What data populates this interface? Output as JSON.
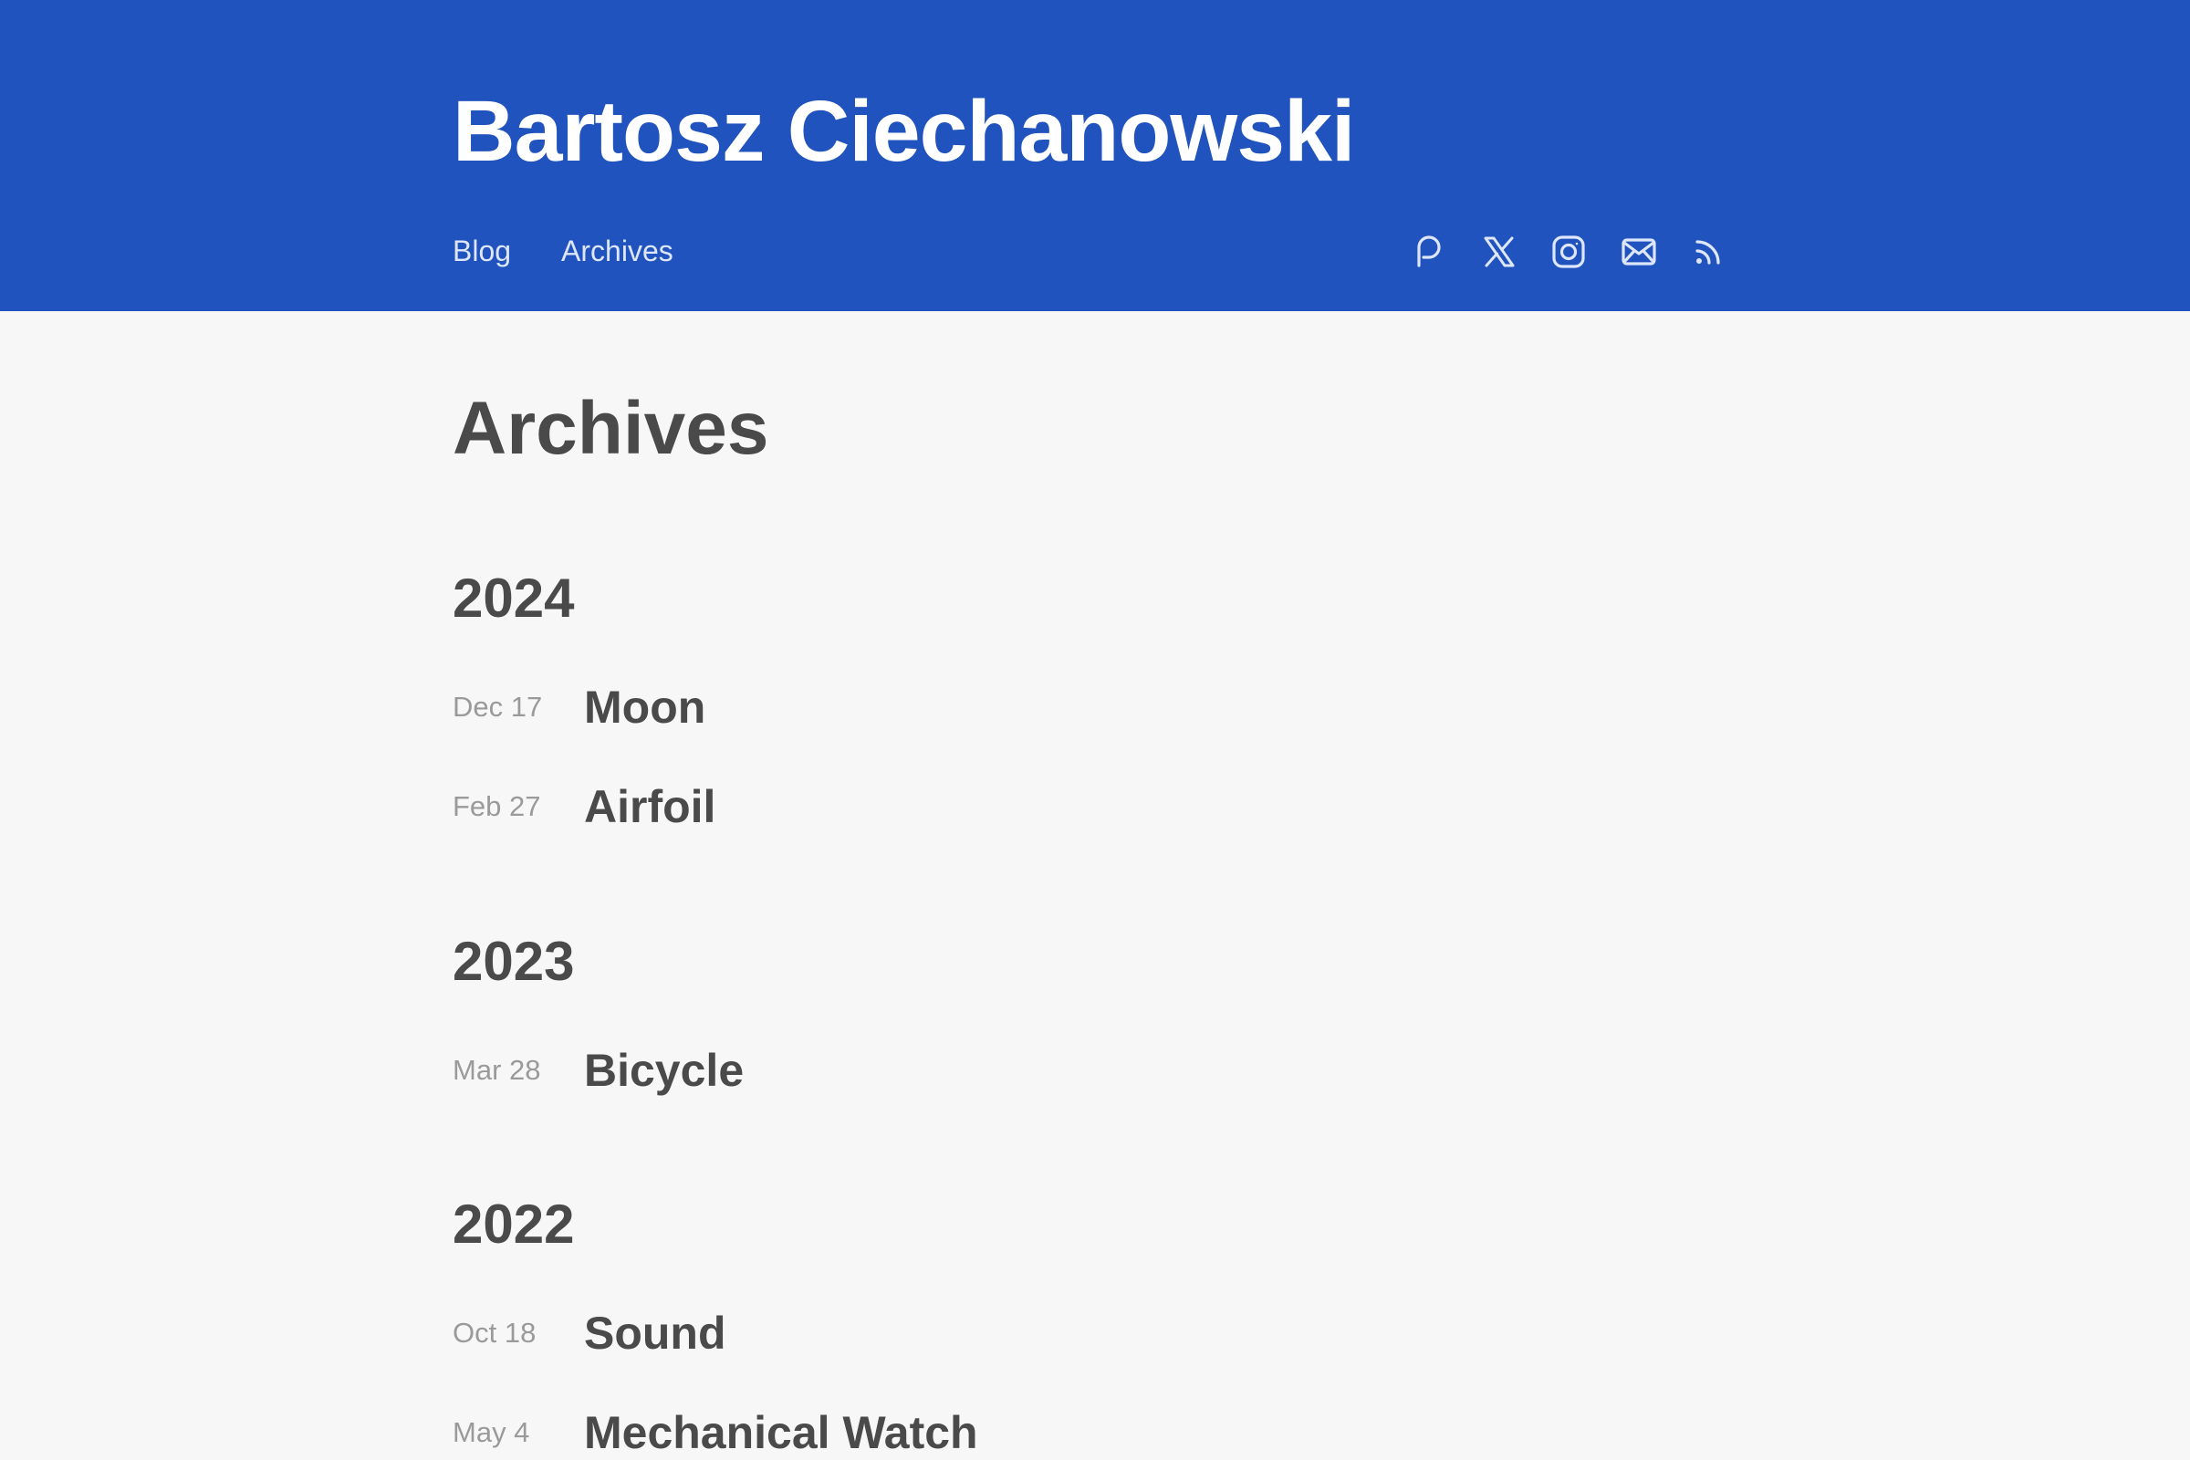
{
  "header": {
    "site_title": "Bartosz Ciechanowski",
    "nav": [
      {
        "label": "Blog"
      },
      {
        "label": "Archives"
      }
    ],
    "social_icons": [
      "patreon-icon",
      "x-icon",
      "instagram-icon",
      "mail-icon",
      "rss-icon"
    ],
    "background_color": "#2053bd"
  },
  "main": {
    "title": "Archives",
    "years": [
      {
        "year": "2024",
        "posts": [
          {
            "date": "Dec 17",
            "title": "Moon"
          },
          {
            "date": "Feb 27",
            "title": "Airfoil"
          }
        ]
      },
      {
        "year": "2023",
        "posts": [
          {
            "date": "Mar 28",
            "title": "Bicycle"
          }
        ]
      },
      {
        "year": "2022",
        "posts": [
          {
            "date": "Oct 18",
            "title": "Sound"
          },
          {
            "date": "May 4",
            "title": "Mechanical Watch"
          }
        ]
      }
    ]
  },
  "colors": {
    "page_background": "#f7f7f7",
    "text": "#4a4a4a",
    "date_text": "#9a9a9a"
  }
}
